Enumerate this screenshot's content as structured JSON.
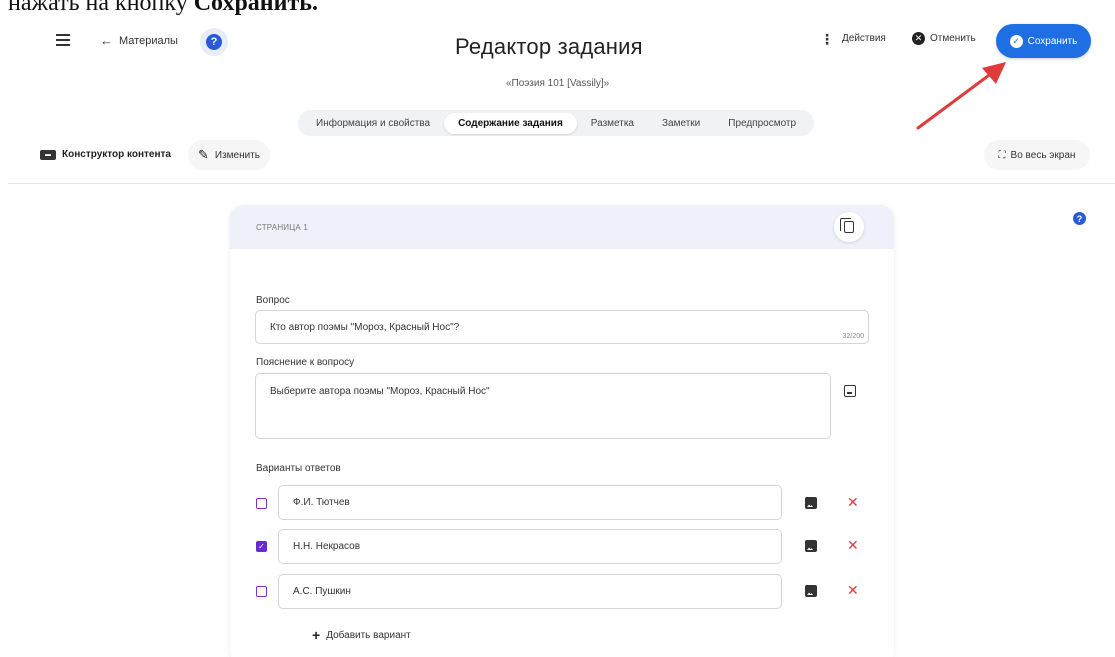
{
  "caption": {
    "text_prefix": "нажать на кнопку ",
    "text_bold": "Сохранить."
  },
  "header": {
    "back_label": "Материалы",
    "title": "Редактор задания",
    "subtitle": "«Поэзия 101 [Vassily]»",
    "actions_label": "Действия",
    "cancel_label": "Отменить",
    "save_label": "Сохранить"
  },
  "tabs": [
    {
      "label": "Информация и свойства",
      "active": false
    },
    {
      "label": "Содержание задания",
      "active": true
    },
    {
      "label": "Разметка",
      "active": false
    },
    {
      "label": "Заметки",
      "active": false
    },
    {
      "label": "Предпросмотр",
      "active": false
    }
  ],
  "toolbar": {
    "constructor_label": "Конструктор контента",
    "edit_label": "Изменить",
    "fullscreen_label": "Во весь экран"
  },
  "card": {
    "page_label": "СТРАНИЦА 1",
    "question_label": "Вопрос",
    "question_value": "Кто автор поэмы \"Мороз, Красный Нос\"?",
    "question_counter": "32/200",
    "explanation_label": "Пояснение к вопросу",
    "explanation_value": "Выберите автора поэмы \"Мороз, Красный Нос\"",
    "answers_label": "Варианты ответов",
    "answers": [
      {
        "text": "Ф.И. Тютчев",
        "checked": false
      },
      {
        "text": "Н.Н. Некрасов",
        "checked": true
      },
      {
        "text": "А.С. Пушкин",
        "checked": false
      }
    ],
    "add_variant_label": "Добавить вариант"
  },
  "colors": {
    "save_button": "#1e6fe3",
    "checkbox_accent": "#6a2ad1",
    "remove": "#e0383e",
    "annotation_arrow": "#e03a3a"
  }
}
